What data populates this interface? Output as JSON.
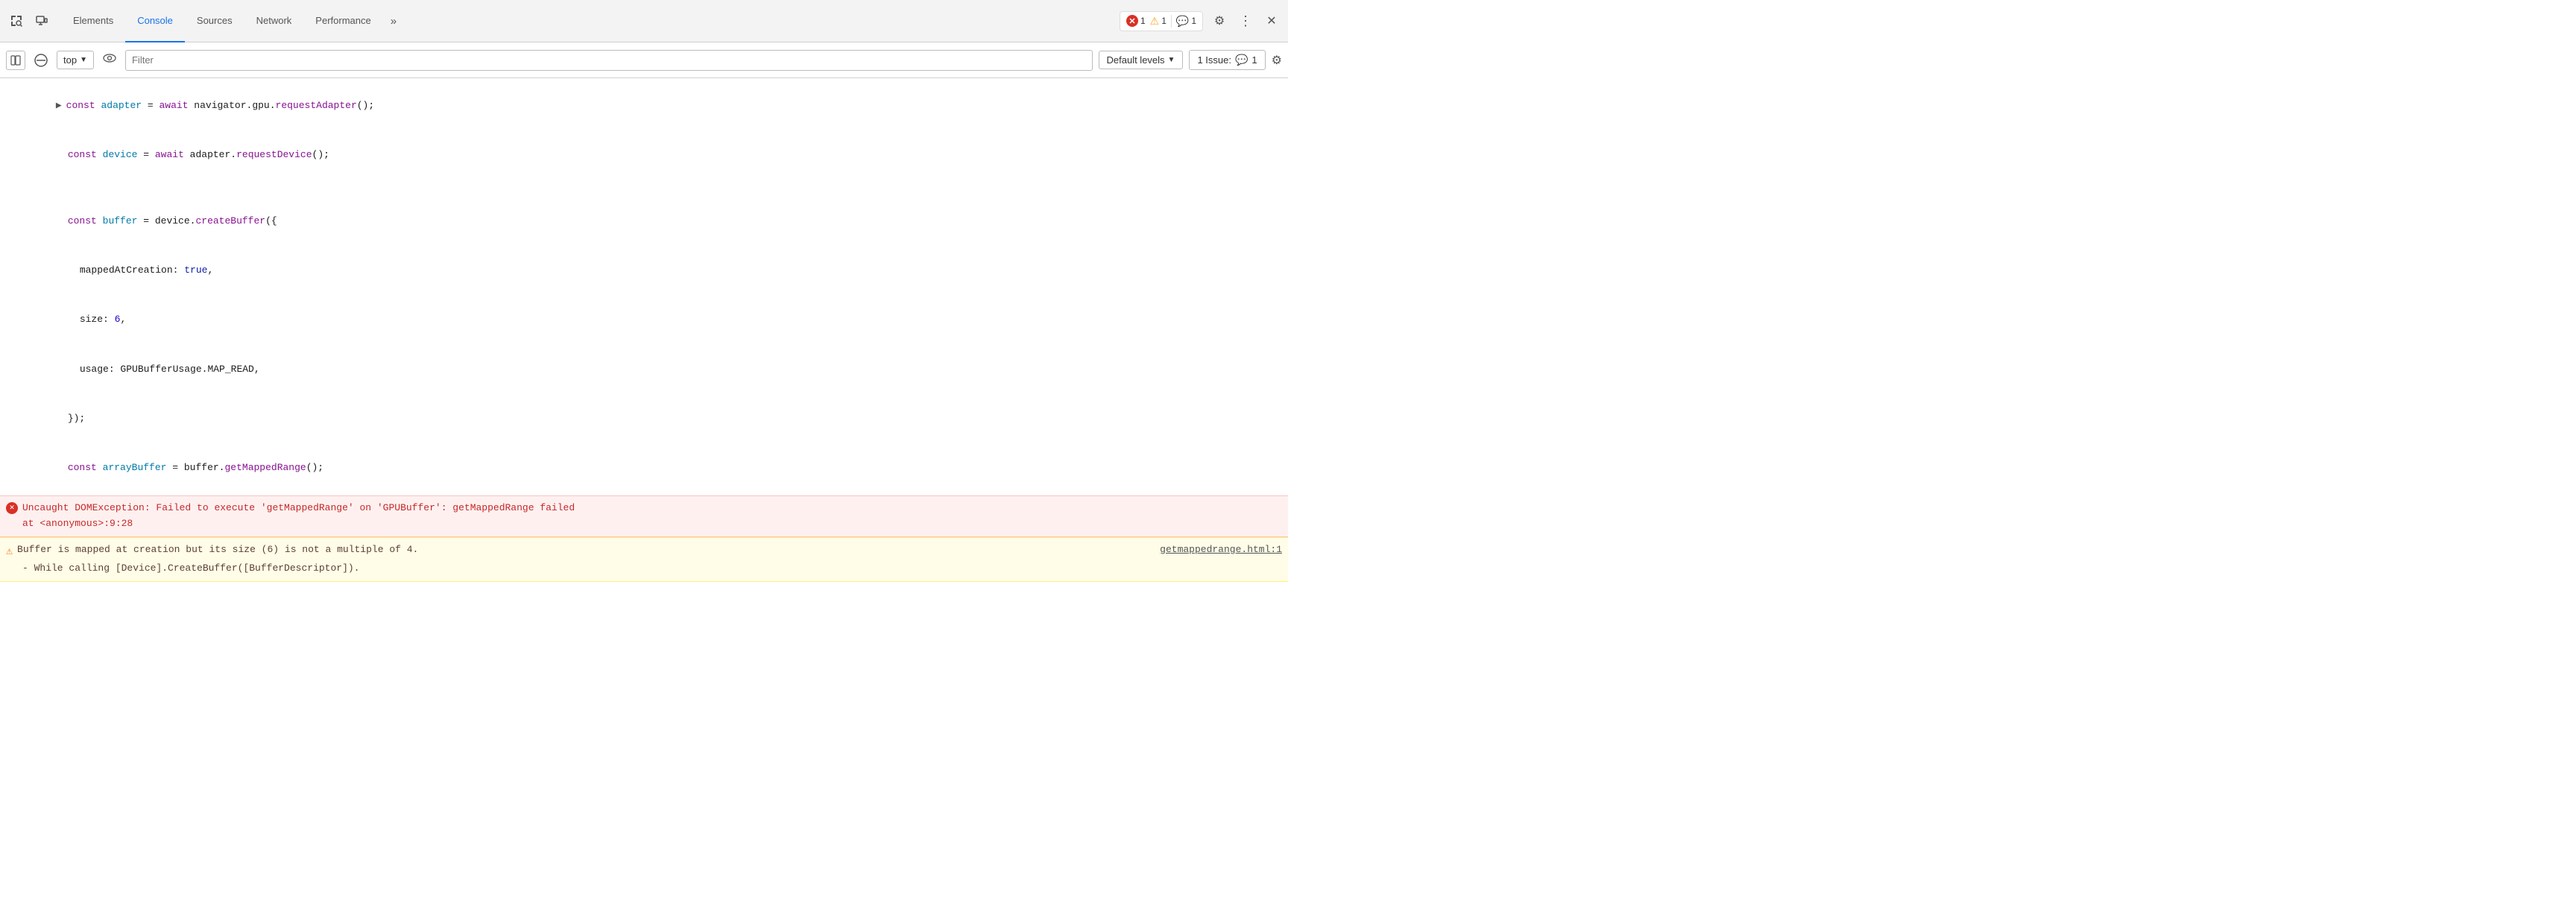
{
  "tabs": {
    "items": [
      {
        "label": "Elements",
        "active": false
      },
      {
        "label": "Console",
        "active": true
      },
      {
        "label": "Sources",
        "active": false
      },
      {
        "label": "Network",
        "active": false
      },
      {
        "label": "Performance",
        "active": false
      }
    ],
    "more_label": "»"
  },
  "toolbar_right": {
    "error_count": "1",
    "warn_count": "1",
    "info_count": "1"
  },
  "second_toolbar": {
    "context_value": "top",
    "filter_placeholder": "Filter",
    "default_levels_label": "Default levels",
    "issue_label": "1 Issue:",
    "issue_count": "1"
  },
  "console": {
    "lines": [
      {
        "type": "code",
        "has_arrow": true,
        "content": "const adapter = await navigator.gpu.requestAdapter();"
      },
      {
        "type": "code",
        "indent": true,
        "content": "const device = await adapter.requestDevice();"
      },
      {
        "type": "blank"
      },
      {
        "type": "code",
        "indent": true,
        "content": "const buffer = device.createBuffer({"
      },
      {
        "type": "code",
        "indent2": true,
        "content": "mappedAtCreation: true,"
      },
      {
        "type": "code",
        "indent2": true,
        "content": "size: 6,"
      },
      {
        "type": "code",
        "indent2": true,
        "content": "usage: GPUBufferUsage.MAP_READ,"
      },
      {
        "type": "code",
        "indent": true,
        "content": "});"
      },
      {
        "type": "code",
        "indent": true,
        "content": "const arrayBuffer = buffer.getMappedRange();"
      }
    ],
    "error": {
      "message": "Uncaught DOMException: Failed to execute 'getMappedRange' on 'GPUBuffer': getMappedRange failed",
      "location": "    at <anonymous>:9:28"
    },
    "warning": {
      "message": "Buffer is mapped at creation but its size (6) is not a multiple of 4.",
      "sub_message": "  - While calling [Device].CreateBuffer([BufferDescriptor]).",
      "link": "getmappedrange.html:1"
    }
  }
}
